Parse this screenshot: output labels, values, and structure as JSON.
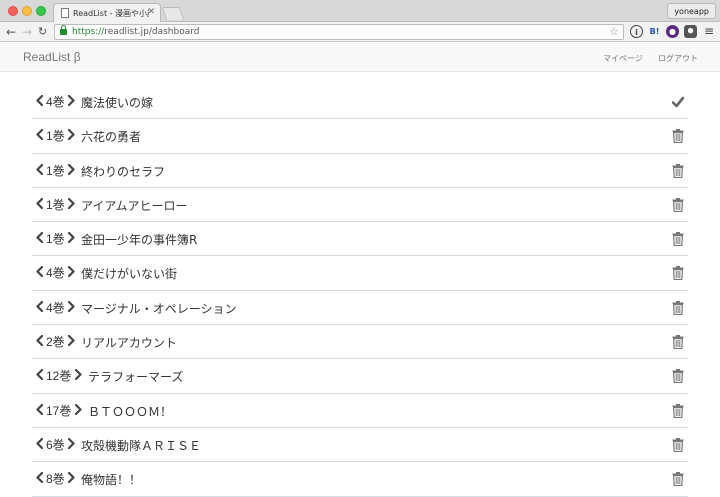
{
  "browser": {
    "tab_title": "ReadList - 漫画や小説を何冊",
    "profile": "yoneapp",
    "url_proto": "https://",
    "url_rest": "readlist.jp/dashboard"
  },
  "app": {
    "brand": "ReadList β",
    "nav": {
      "mypage": "マイページ",
      "logout": "ログアウト"
    }
  },
  "books": [
    {
      "vol": "4巻",
      "title": "魔法使いの嫁",
      "action": "check"
    },
    {
      "vol": "1巻",
      "title": "六花の勇者",
      "action": "trash"
    },
    {
      "vol": "1巻",
      "title": "終わりのセラフ",
      "action": "trash"
    },
    {
      "vol": "1巻",
      "title": "アイアムアヒーロー",
      "action": "trash"
    },
    {
      "vol": "1巻",
      "title": "金田一少年の事件簿R",
      "action": "trash"
    },
    {
      "vol": "4巻",
      "title": "僕だけがいない街",
      "action": "trash"
    },
    {
      "vol": "4巻",
      "title": "マージナル・オペレーション",
      "action": "trash"
    },
    {
      "vol": "2巻",
      "title": "リアルアカウント",
      "action": "trash"
    },
    {
      "vol": "12巻",
      "title": "テラフォーマーズ",
      "action": "trash"
    },
    {
      "vol": "17巻",
      "title": "ＢＴＯＯＯＭ！",
      "action": "trash"
    },
    {
      "vol": "6巻",
      "title": "攻殻機動隊ＡＲＩＳＥ",
      "action": "trash"
    },
    {
      "vol": "8巻",
      "title": "俺物語！！",
      "action": "trash"
    }
  ],
  "colors": {
    "icon": "#777777",
    "divider": "#d3dde6",
    "text": "#333333"
  }
}
